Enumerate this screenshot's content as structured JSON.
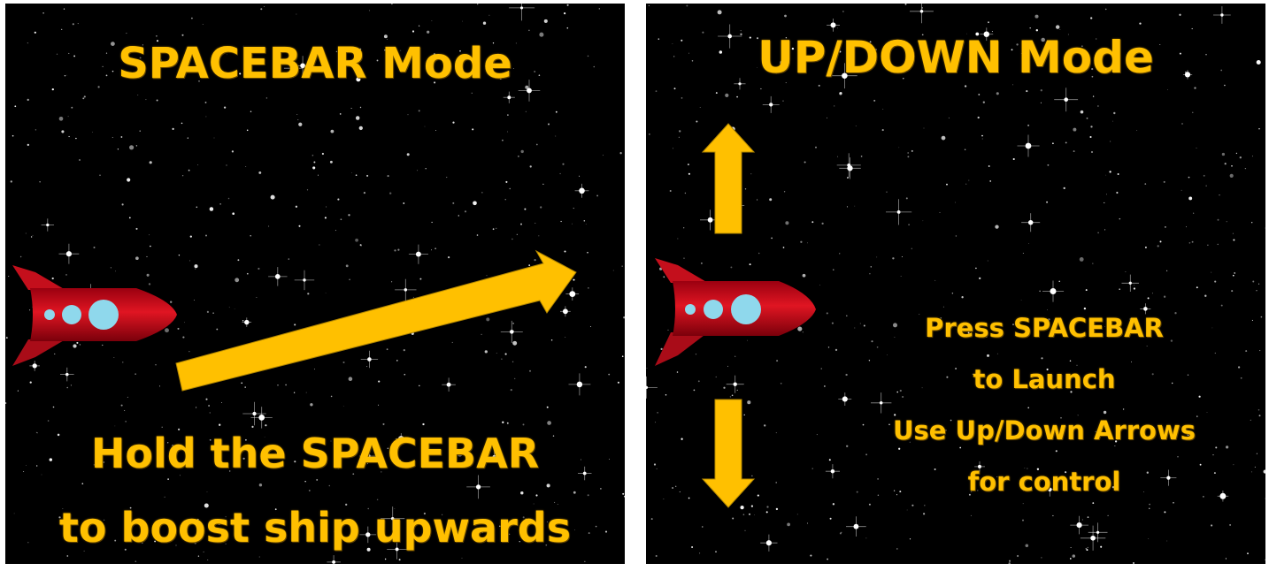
{
  "left_panel": {
    "title": "SPACEBAR Mode",
    "caption_line1": "Hold the SPACEBAR",
    "caption_line2": "to boost ship upwards"
  },
  "right_panel": {
    "title": "UP/DOWN Mode",
    "instructions": [
      "Press SPACEBAR",
      "to Launch",
      "Use Up/Down Arrows",
      "for control"
    ]
  },
  "colors": {
    "text_accent": "#FFC000",
    "arrow": "#FFC000",
    "ship_body": "#D4111E",
    "ship_windows": "#8FD8EC",
    "background": "#000000"
  },
  "icons": [
    "rocket-ship-icon",
    "diagonal-arrow-icon",
    "up-arrow-icon",
    "down-arrow-icon"
  ]
}
